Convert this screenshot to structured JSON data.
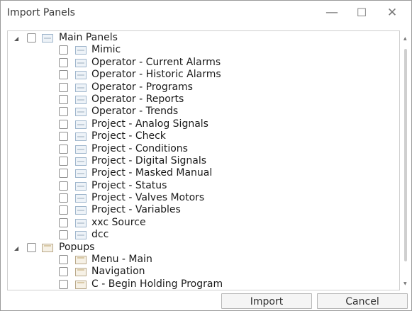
{
  "window": {
    "title": "Import Panels",
    "controls": {
      "minimize": "—",
      "maximize": "☐",
      "close": "✕"
    }
  },
  "tree": {
    "groups": [
      {
        "label": "Main Panels",
        "expanded": true,
        "items": [
          "Mimic",
          "Operator - Current Alarms",
          "Operator - Historic Alarms",
          "Operator - Programs",
          "Operator - Reports",
          "Operator - Trends",
          "Project - Analog Signals",
          "Project - Check",
          "Project - Conditions",
          "Project - Digital Signals",
          "Project - Masked Manual",
          "Project - Status",
          "Project - Valves Motors",
          "Project - Variables",
          "xxc Source",
          "dcc"
        ]
      },
      {
        "label": "Popups",
        "expanded": true,
        "items": [
          "Menu - Main",
          "Navigation",
          "C - Begin Holding Program"
        ]
      }
    ]
  },
  "buttons": {
    "import": "Import",
    "cancel": "Cancel"
  }
}
